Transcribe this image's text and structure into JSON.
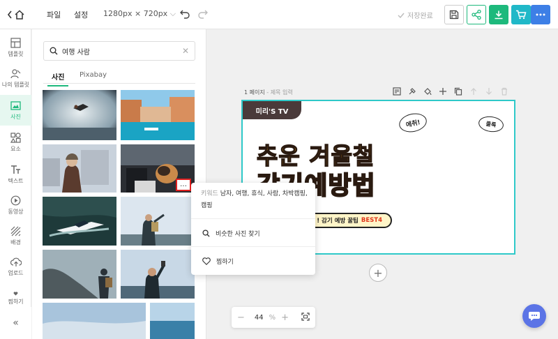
{
  "toolbar": {
    "file_label": "파일",
    "settings_label": "설정",
    "size_label": "1280px × 720px",
    "saved_label": "저장완료",
    "colors": {
      "share": "#1db97c",
      "download": "#1db97c",
      "cart": "#20b8c8",
      "more": "#3d7fe6"
    }
  },
  "sidebar": {
    "items": [
      {
        "label": "템플릿",
        "icon": "template-icon"
      },
      {
        "label": "나의 템플릿",
        "icon": "my-template-icon"
      },
      {
        "label": "사진",
        "icon": "photo-icon"
      },
      {
        "label": "요소",
        "icon": "elements-icon"
      },
      {
        "label": "텍스트",
        "icon": "text-icon"
      },
      {
        "label": "동영상",
        "icon": "video-icon"
      },
      {
        "label": "배경",
        "icon": "background-icon"
      },
      {
        "label": "업로드",
        "icon": "upload-icon"
      },
      {
        "label": "찜하기",
        "icon": "heart-icon"
      }
    ],
    "collapse_glyph": "«"
  },
  "panel": {
    "search_value": "여행 사람",
    "tabs": [
      "사진",
      "Pixabay"
    ]
  },
  "canvas": {
    "page_label": "1 페이지",
    "page_title_placeholder": "- 제목 입력",
    "zoom_value": "44",
    "zoom_unit": "%"
  },
  "design": {
    "badge": "미리'S TV",
    "bubble1": "에취!",
    "bubble2": "콜록",
    "title_line1": "추운 겨울철",
    "title_line2": "감기예방법",
    "banner_prefix": "! 감기 예방 꿀팁",
    "banner_highlight": "BEST4"
  },
  "popup": {
    "keyword_prefix": "키워드",
    "keywords": "남자, 여행, 휴식, 사람, 차박캠핑, 캠핑",
    "find_similar": "비슷한 사진 찾기",
    "favorite": "찜하기"
  },
  "more_button": "…"
}
